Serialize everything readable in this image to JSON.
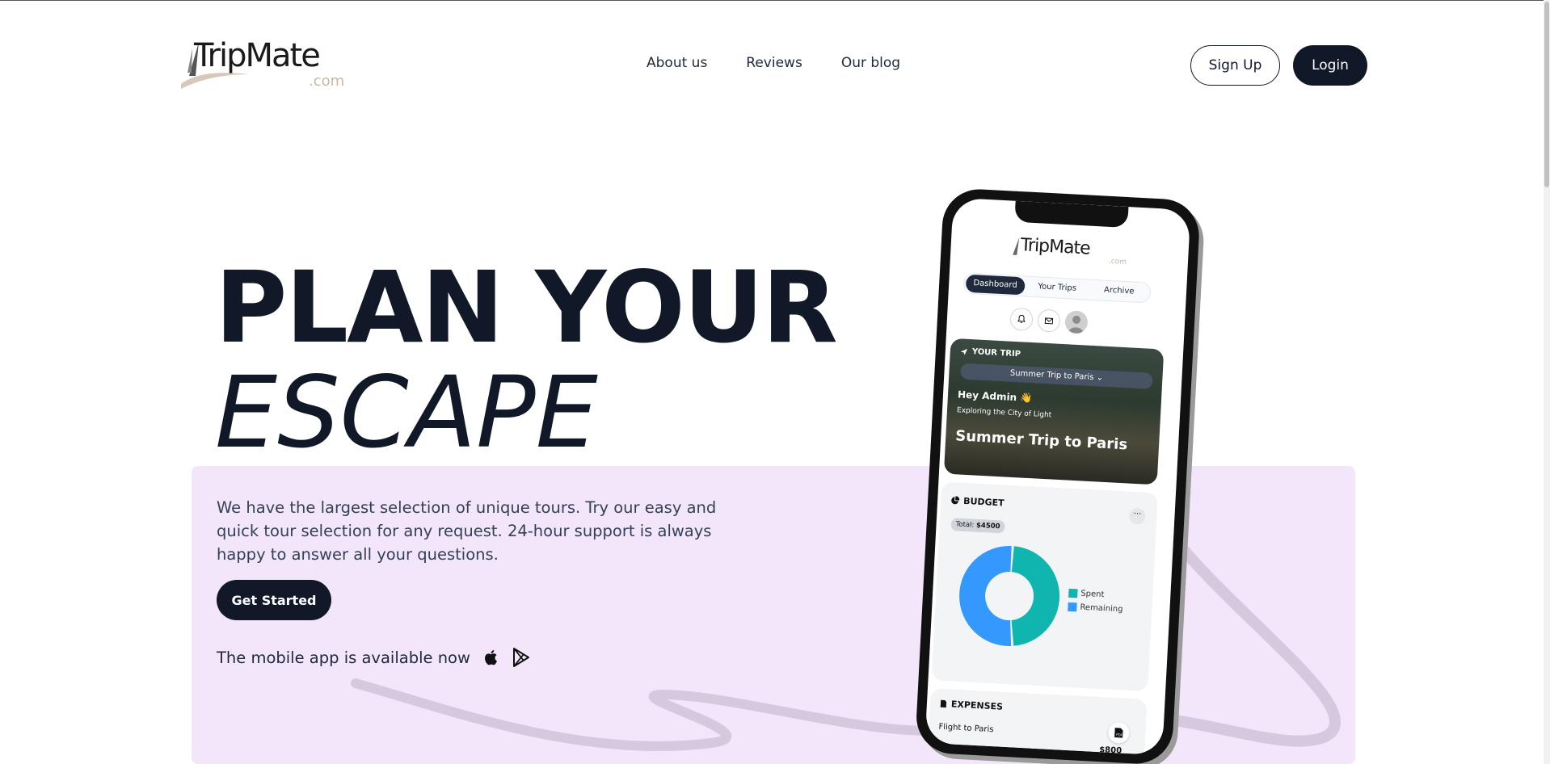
{
  "header": {
    "logo_text": "TripMate",
    "logo_suffix": ".com",
    "nav": [
      "About us",
      "Reviews",
      "Our blog"
    ],
    "signup_label": "Sign Up",
    "login_label": "Login"
  },
  "hero": {
    "title_line1": "PLAN YOUR",
    "title_line2": "ESCAPE",
    "description": "We have the largest selection of unique tours. Try our easy and quick tour selection for any request. 24-hour support is always happy to answer all your questions.",
    "cta_label": "Get Started",
    "app_available": "The mobile app is available now",
    "store_icons": [
      "apple-icon",
      "google-play-icon"
    ]
  },
  "phone": {
    "logo_text": "TripMate",
    "logo_suffix": ".com",
    "tabs": [
      "Dashboard",
      "Your Trips",
      "Archive"
    ],
    "active_tab": "Dashboard",
    "trip_section_title": "YOUR TRIP",
    "trip_select": "Summer Trip to Paris",
    "greeting": "Hey Admin",
    "greeting_emoji": "👋",
    "subtitle": "Exploring the City of Light",
    "trip_name": "Summer Trip to Paris",
    "budget_title": "BUDGET",
    "budget_total_label": "Total:",
    "budget_total_value": "$4500",
    "expenses_title": "EXPENSES",
    "expense_item": "Flight to Paris",
    "expense_amount": "$800"
  },
  "chart_data": {
    "type": "pie",
    "categories": [
      "Spent",
      "Remaining"
    ],
    "values": [
      48,
      52
    ],
    "colors": [
      "#0fb5ae",
      "#3399ff"
    ],
    "legend": "right",
    "donut": true
  },
  "colors": {
    "primary_dark": "#111827",
    "panel": "#f3e6fb",
    "spent": "#0fb5ae",
    "remaining": "#3399ff",
    "logo_accent": "#c8b6a6"
  }
}
